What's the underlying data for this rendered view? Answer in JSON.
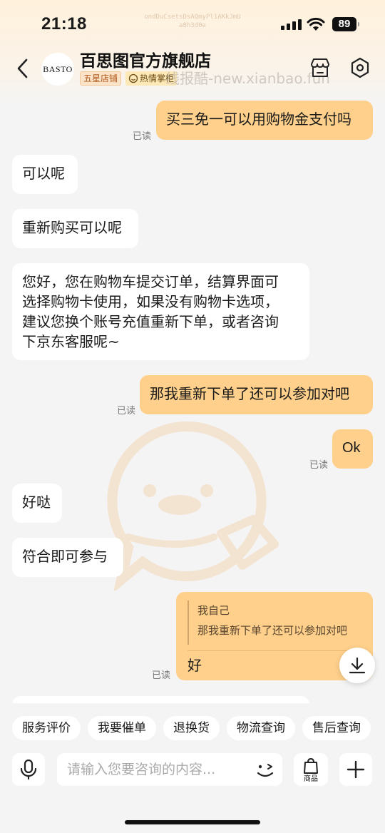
{
  "status_bar": {
    "time": "21:18",
    "faint_id_line1": "ondDuCsetsDsAQmyPl1AKkJmU",
    "faint_id_line2": "a8h3d0e",
    "battery": "89"
  },
  "header": {
    "shop_name": "百思图官方旗舰店",
    "avatar_text": "BASTO",
    "badge_star": "五星店铺",
    "badge_hot": "热情掌柜",
    "watermark": "线报酷-new.xianbao.fun"
  },
  "messages": [
    {
      "side": "out",
      "text": "买三免一可以用购物金支付吗",
      "read": "已读"
    },
    {
      "side": "in",
      "text": "可以呢"
    },
    {
      "side": "in",
      "text": "重新购买可以呢"
    },
    {
      "side": "in",
      "lines": [
        "您好，您在购物车提交订单，结算界面可",
        "选择购物卡使用，如果没有购物卡选项，",
        "建议您换个账号充值重新下单，或者咨询",
        "下京东客服呢~"
      ]
    },
    {
      "side": "out",
      "text": "那我重新下单了还可以参加对吧",
      "read": "已读"
    },
    {
      "side": "out",
      "text": "Ok",
      "read": "已读"
    },
    {
      "side": "in",
      "text": "好哒"
    },
    {
      "side": "in",
      "text": "符合即可参与"
    },
    {
      "side": "out",
      "quote_author": "我自己",
      "quote_text": "那我重新下单了还可以参加对吧",
      "text": "好",
      "read": "已读"
    }
  ],
  "quick_actions": [
    "服务评价",
    "我要催单",
    "退换货",
    "物流查询",
    "售后查询"
  ],
  "input": {
    "placeholder": "请输入您要咨询的内容...",
    "goods_label": "商品"
  },
  "colors": {
    "accent_bubble": "#fed08b",
    "page_bg": "#f4f4f4",
    "badge_star_text": "#b15a1e"
  }
}
